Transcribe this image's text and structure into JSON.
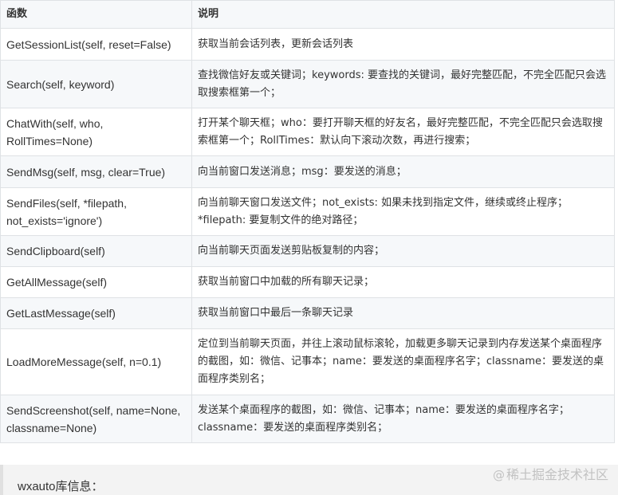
{
  "table": {
    "headers": [
      "函数",
      "说明"
    ],
    "rows": [
      {
        "fn": "GetSessionList(self, reset=False)",
        "desc": "获取当前会话列表，更新会话列表"
      },
      {
        "fn": "Search(self, keyword)",
        "desc": "查找微信好友或关键词；keywords: 要查找的关键词，最好完整匹配，不完全匹配只会选取搜索框第一个；"
      },
      {
        "fn": "ChatWith(self, who, RollTimes=None)",
        "desc": "打开某个聊天框；who：要打开聊天框的好友名，最好完整匹配，不完全匹配只会选取搜索框第一个；RollTimes：默认向下滚动次数，再进行搜索；"
      },
      {
        "fn": "SendMsg(self, msg, clear=True)",
        "desc": "向当前窗口发送消息；msg：要发送的消息；"
      },
      {
        "fn": "SendFiles(self, *filepath, not_exists='ignore')",
        "desc": "向当前聊天窗口发送文件；not_exists: 如果未找到指定文件，继续或终止程序；*filepath: 要复制文件的绝对路径；"
      },
      {
        "fn": "SendClipboard(self)",
        "desc": "向当前聊天页面发送剪贴板复制的内容；"
      },
      {
        "fn": "GetAllMessage(self)",
        "desc": "获取当前窗口中加载的所有聊天记录；"
      },
      {
        "fn": "GetLastMessage(self)",
        "desc": "获取当前窗口中最后一条聊天记录"
      },
      {
        "fn": "LoadMoreMessage(self, n=0.1)",
        "desc": "定位到当前聊天页面，并往上滚动鼠标滚轮，加载更多聊天记录到内存发送某个桌面程序的截图，如：微信、记事本；name：要发送的桌面程序名字；classname：要发送的桌面程序类别名；"
      },
      {
        "fn": "SendScreenshot(self, name=None, classname=None)",
        "desc": "发送某个桌面程序的截图，如：微信、记事本；name：要发送的桌面程序名字；classname：要发送的桌面程序类别名；"
      }
    ]
  },
  "section": {
    "title": "wxauto库信息："
  },
  "watermark": {
    "at": "@",
    "text": "稀土掘金技术社区"
  }
}
